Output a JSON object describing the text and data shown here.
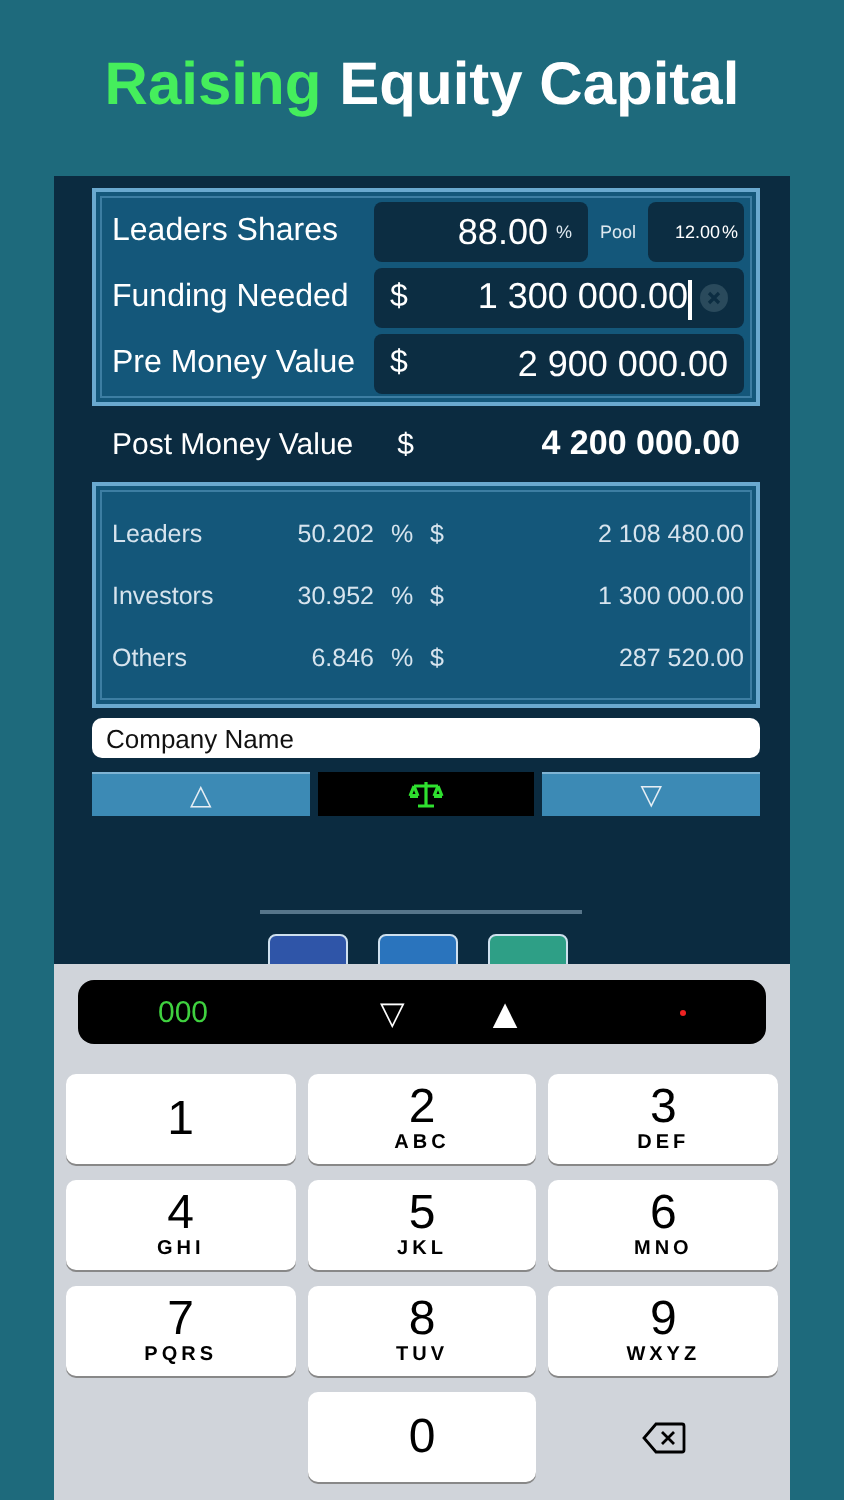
{
  "title": {
    "highlight": "Raising",
    "rest": "Equity Capital"
  },
  "inputs": [
    {
      "kind": "percent",
      "label": "Leaders Shares",
      "value": "88.00",
      "unit": "%",
      "extra_label": "Pool",
      "extra_value": "12.00",
      "extra_unit": "%"
    },
    {
      "kind": "money",
      "label": "Funding Needed",
      "currency": "$",
      "value": "1 300 000.00",
      "focused": true
    },
    {
      "kind": "money",
      "label": "Pre Money Value",
      "currency": "$",
      "value": "2 900 000.00",
      "focused": false
    }
  ],
  "post_money": {
    "label": "Post Money Value",
    "currency": "$",
    "value": "4 200 000.00"
  },
  "results": [
    {
      "label": "Leaders",
      "percent": "50.202",
      "unit": "%",
      "currency": "$",
      "amount": "2 108 480.00"
    },
    {
      "label": "Investors",
      "percent": "30.952",
      "unit": "%",
      "currency": "$",
      "amount": "1 300 000.00"
    },
    {
      "label": "Others",
      "percent": "6.846",
      "unit": "%",
      "currency": "$",
      "amount": "287 520.00"
    }
  ],
  "company_field": {
    "value": "Company Name"
  },
  "nav": {
    "up": "△",
    "down": "▽"
  },
  "accessory": {
    "counter": "000",
    "down": "▽",
    "up": "▲"
  },
  "keys": [
    [
      {
        "kind": "digit",
        "digit": "1"
      },
      {
        "kind": "digit",
        "digit": "2",
        "letters": "ABC"
      },
      {
        "kind": "digit",
        "digit": "3",
        "letters": "DEF"
      }
    ],
    [
      {
        "kind": "digit",
        "digit": "4",
        "letters": "GHI"
      },
      {
        "kind": "digit",
        "digit": "5",
        "letters": "JKL"
      },
      {
        "kind": "digit",
        "digit": "6",
        "letters": "MNO"
      }
    ],
    [
      {
        "kind": "digit",
        "digit": "7",
        "letters": "PQRS"
      },
      {
        "kind": "digit",
        "digit": "8",
        "letters": "TUV"
      },
      {
        "kind": "digit",
        "digit": "9",
        "letters": "WXYZ"
      }
    ],
    [
      {
        "kind": "empty"
      },
      {
        "kind": "digit",
        "digit": "0"
      },
      {
        "kind": "backspace"
      }
    ]
  ]
}
